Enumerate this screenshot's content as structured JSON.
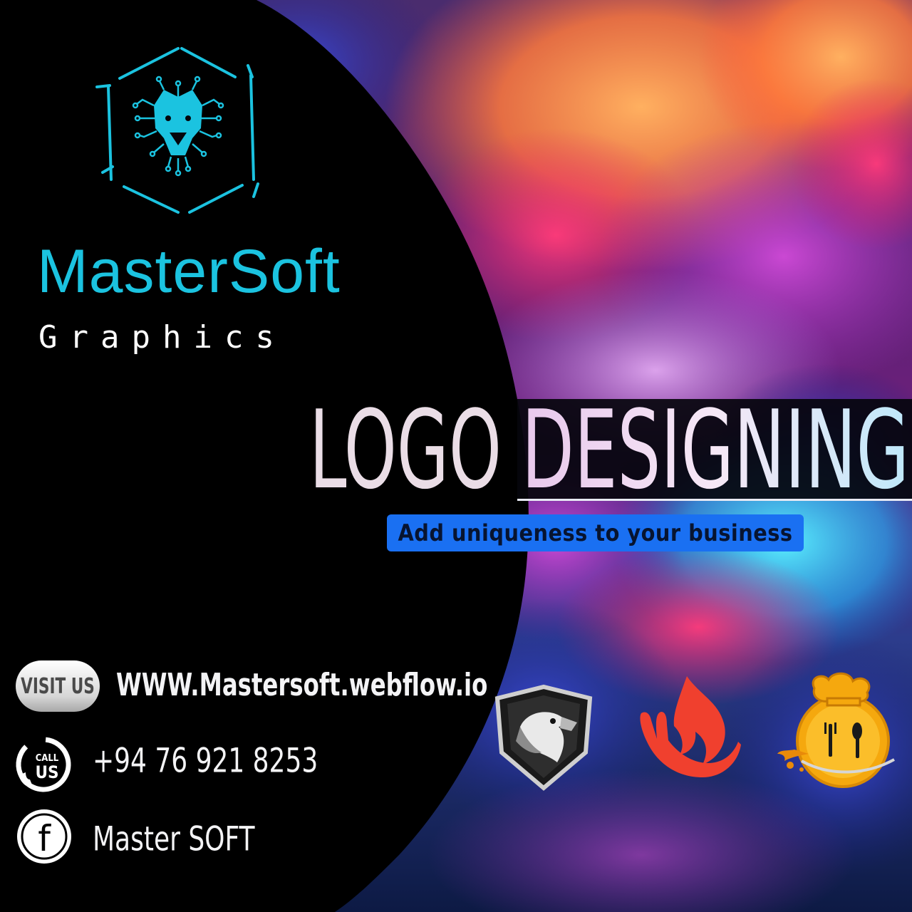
{
  "colors": {
    "brand_cyan": "#1bc3e0",
    "panel_black": "#000000",
    "tagline_blue": "#1a70f2",
    "text_light": "#f3f3f5"
  },
  "brand": {
    "name": "MasterSoft",
    "subtitle": "Graphics",
    "emblem": "lion-circuit-hexagon-icon"
  },
  "headline": {
    "word1": "LOGO",
    "word2": "DESIGNING",
    "tagline": "Add uniqueness to your business"
  },
  "contact": {
    "visit_badge": "VISIT US",
    "website": "WWW.Mastersoft.webflow.io",
    "call_badge_top": "CALL",
    "call_badge_bottom": "US",
    "phone": "+94 76 921 8253",
    "facebook_glyph": "f",
    "facebook_name": "Master SOFT"
  },
  "sample_logos": [
    "eagle-shield-icon",
    "flame-hand-icon",
    "chef-restaurant-icon"
  ]
}
